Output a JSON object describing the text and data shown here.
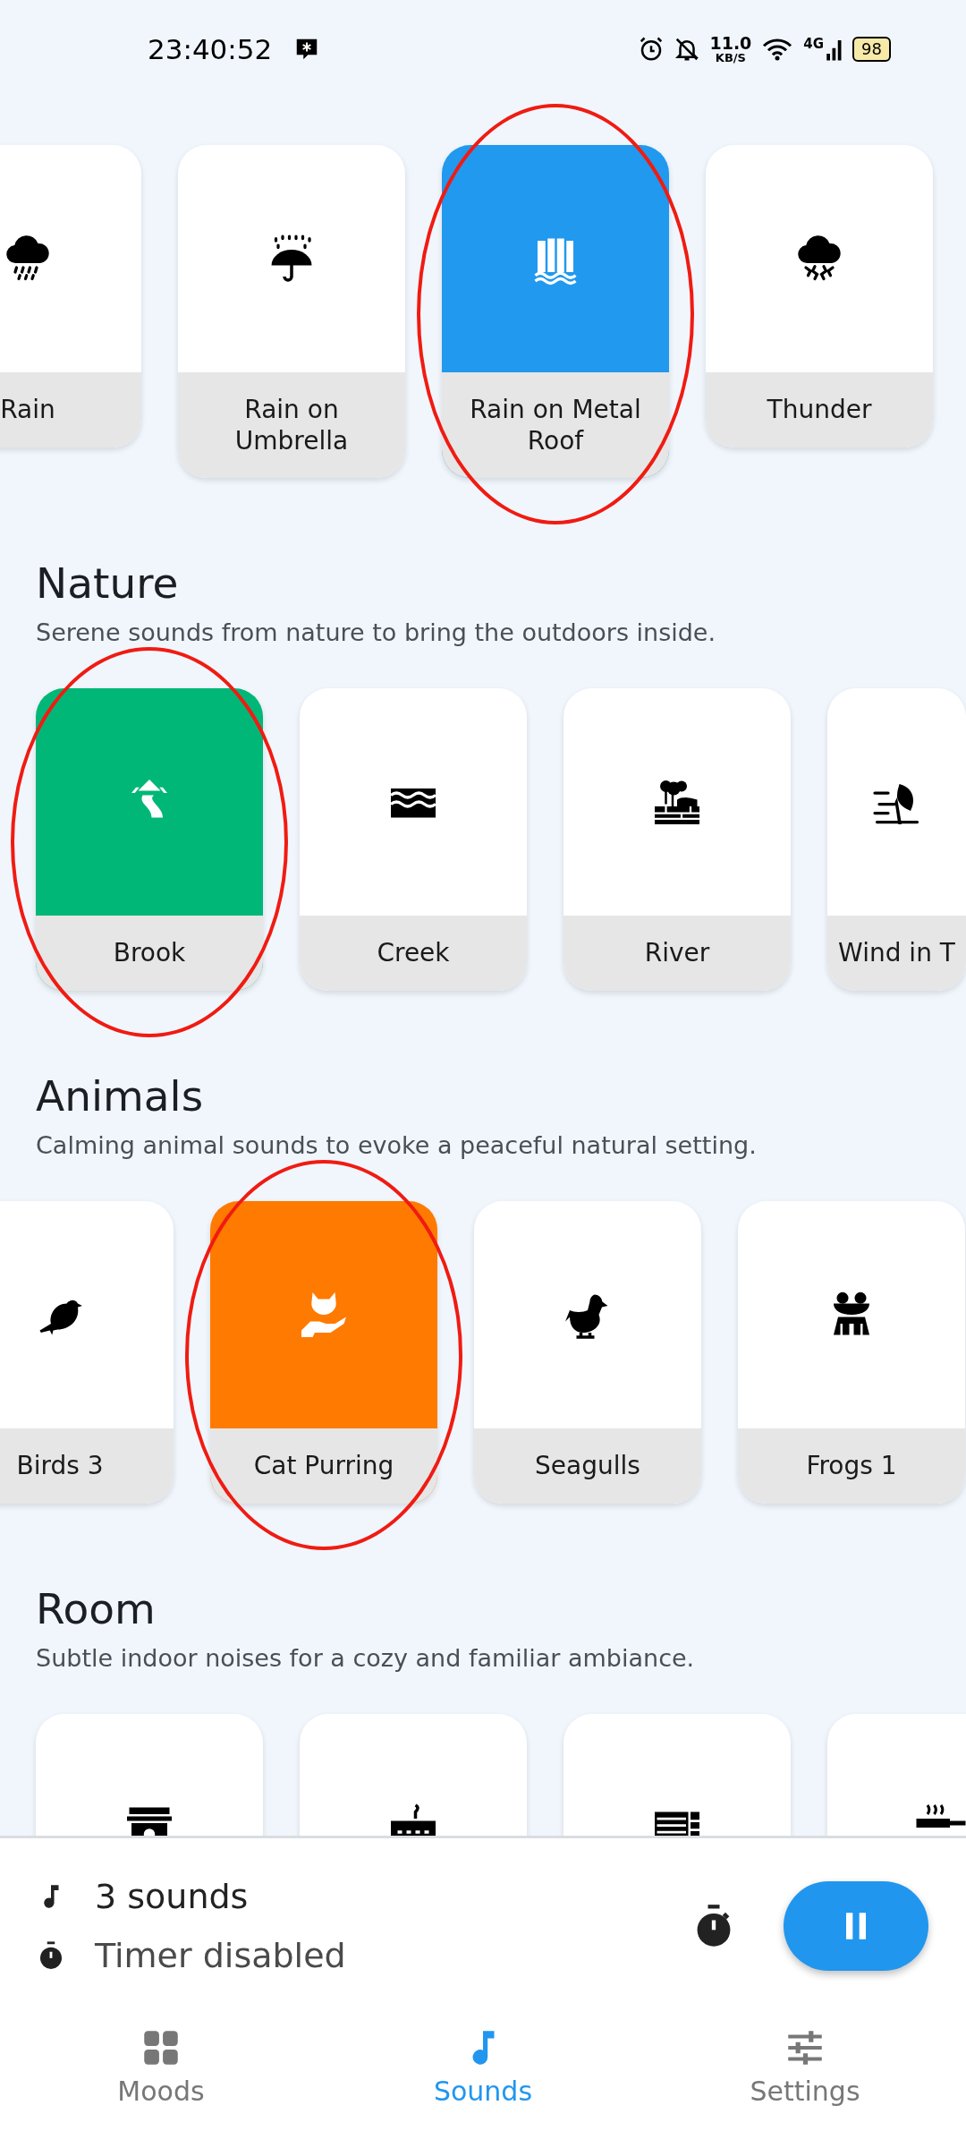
{
  "status_bar": {
    "time": "23:40:52",
    "network_speed": "11.0",
    "speed_unit": "KB/S",
    "network_type": "4G",
    "battery": "98"
  },
  "sections": [
    {
      "sounds": [
        {
          "label": "Rain",
          "selected": false,
          "circled": false
        },
        {
          "label": "Rain on Umbrella",
          "selected": false,
          "circled": false
        },
        {
          "label": "Rain on Metal Roof",
          "selected": true,
          "circled": true,
          "color": "#2199ee"
        },
        {
          "label": "Thunder",
          "selected": false,
          "circled": false
        }
      ]
    },
    {
      "title": "Nature",
      "subtitle": "Serene sounds from nature to bring the outdoors inside.",
      "sounds": [
        {
          "label": "Brook",
          "selected": true,
          "circled": true,
          "color": "#00b777"
        },
        {
          "label": "Creek",
          "selected": false,
          "circled": false
        },
        {
          "label": "River",
          "selected": false,
          "circled": false
        },
        {
          "label": "Wind in T",
          "selected": false,
          "circled": false
        }
      ]
    },
    {
      "title": "Animals",
      "subtitle": "Calming animal sounds to evoke a peaceful natural setting.",
      "sounds": [
        {
          "label": "Birds 3",
          "selected": false,
          "circled": false
        },
        {
          "label": "Cat Purring",
          "selected": true,
          "circled": true,
          "color": "#ff7a00"
        },
        {
          "label": "Seagulls",
          "selected": false,
          "circled": false
        },
        {
          "label": "Frogs 1",
          "selected": false,
          "circled": false
        }
      ]
    },
    {
      "title": "Room",
      "subtitle": "Subtle indoor noises for a cozy and familiar ambiance.",
      "sounds": [
        {
          "selected": false,
          "circled": false
        },
        {
          "selected": false,
          "circled": false
        },
        {
          "selected": false,
          "circled": false
        },
        {
          "selected": false,
          "circled": false
        }
      ]
    }
  ],
  "player": {
    "sounds_count": "3 sounds",
    "timer_status": "Timer disabled",
    "playing": true
  },
  "nav": [
    {
      "label": "Moods",
      "selected": false
    },
    {
      "label": "Sounds",
      "selected": true
    },
    {
      "label": "Settings",
      "selected": false
    }
  ]
}
